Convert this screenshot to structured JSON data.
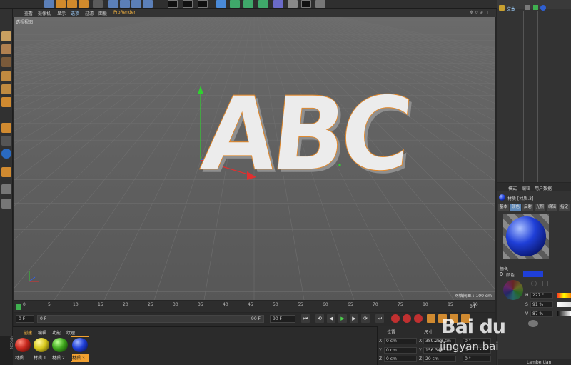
{
  "viewport": {
    "menu": [
      "查看",
      "摄像机",
      "显示",
      "选项",
      "过滤",
      "面板",
      "ProRender"
    ],
    "title": "透视视图",
    "text_object": "ABC",
    "grid_spacing": "网格间距 : 100 cm"
  },
  "timeline": {
    "ticks": [
      "0",
      "5",
      "10",
      "15",
      "20",
      "25",
      "30",
      "35",
      "40",
      "45",
      "50",
      "55",
      "60",
      "65",
      "70",
      "75",
      "80",
      "85",
      "90"
    ],
    "current_frame": "0 F",
    "start_frame": "0 F",
    "min_frame": "0 F",
    "end_frame": "90 F",
    "max_frame": "90 F"
  },
  "material_manager": {
    "menu": [
      "创建",
      "编辑",
      "功能",
      "纹理"
    ],
    "materials": [
      {
        "name": "材质",
        "color": "#c8281e"
      },
      {
        "name": "材质.1",
        "color": "#d8c81c"
      },
      {
        "name": "材质.2",
        "color": "#3fa81c"
      },
      {
        "name": "材质.3",
        "color": "#1f3fd8"
      }
    ]
  },
  "coordinates": {
    "header": [
      "位置",
      "尺寸"
    ],
    "rows": [
      {
        "axis": "X",
        "pos": "0 cm",
        "size": "389.258 cm"
      },
      {
        "axis": "Y",
        "pos": "0 cm",
        "size": "156.348 cm"
      },
      {
        "axis": "Z",
        "pos": "0 cm",
        "size": "20 cm"
      }
    ],
    "rot": [
      "0 °",
      "0 °",
      "0 °"
    ]
  },
  "object_manager": {
    "item": "文本"
  },
  "attributes": {
    "menu": [
      "模式",
      "编辑",
      "用户数据"
    ],
    "material_title": "材质 [材质.3]",
    "tabs": [
      "基本",
      "颜色",
      "反射",
      "光照",
      "编辑",
      "指定"
    ],
    "section": "颜色",
    "color_label": "颜色",
    "hsv": [
      {
        "label": "H",
        "value": "227 °"
      },
      {
        "label": "S",
        "value": "91 %"
      },
      {
        "label": "V",
        "value": "87 %"
      }
    ],
    "shader": "Lambertian",
    "accent_color": "#1f3fd8"
  },
  "watermark": {
    "logo": "Bai du",
    "url": "jingyan.bai"
  }
}
